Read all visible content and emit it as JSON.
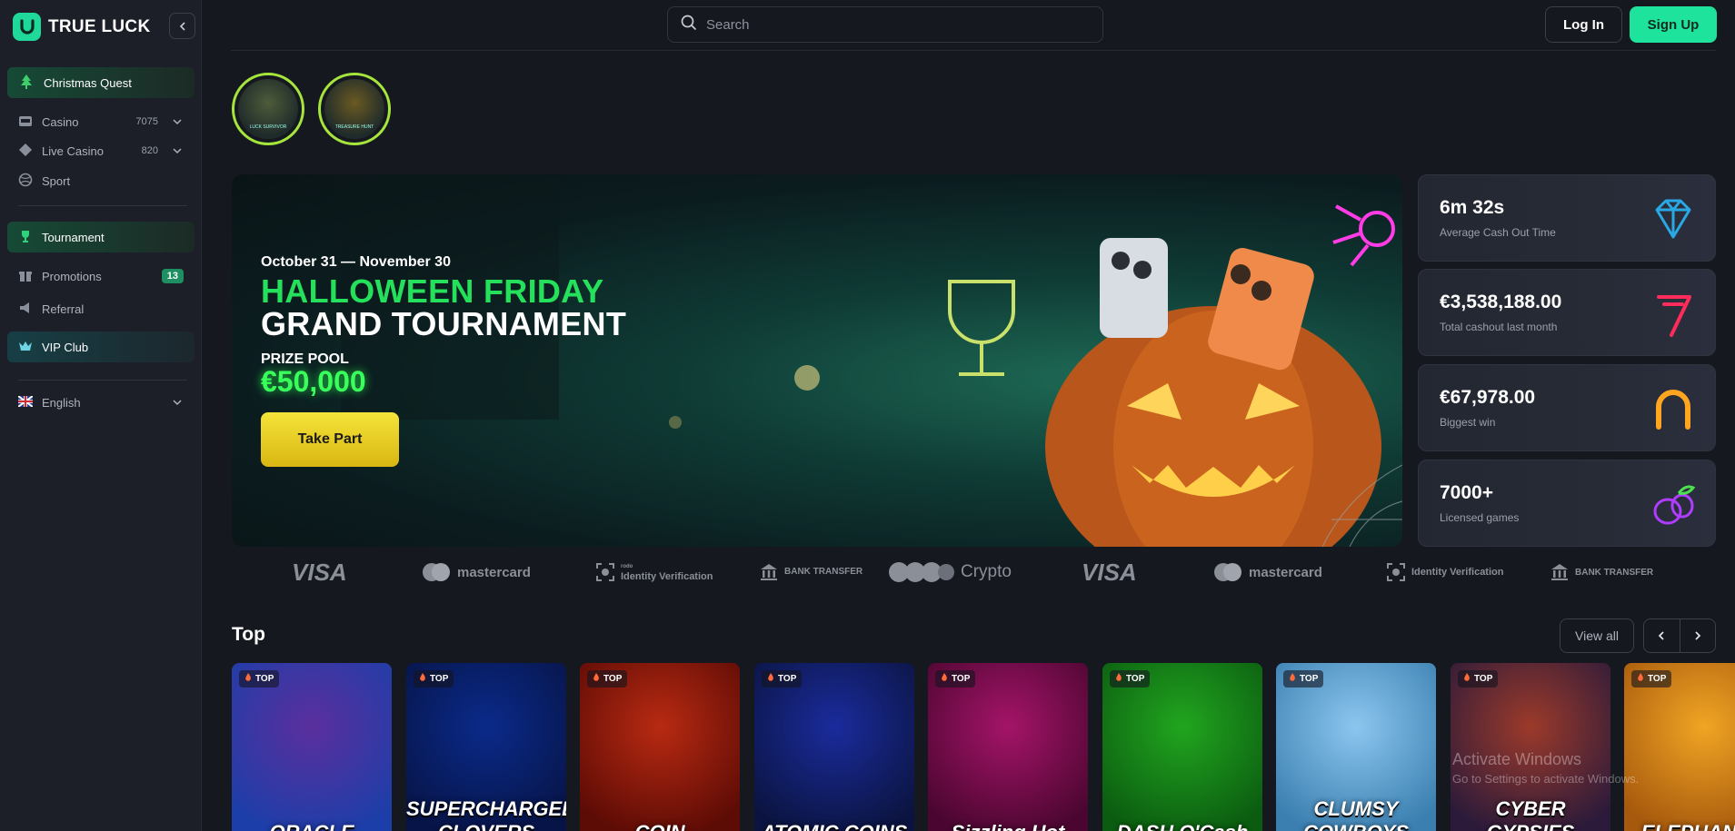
{
  "brand": {
    "name": "TRUE LUCK"
  },
  "sidebar": {
    "items": [
      {
        "label": "Christmas Quest"
      },
      {
        "label": "Casino",
        "count": "7075"
      },
      {
        "label": "Live Casino",
        "count": "820"
      },
      {
        "label": "Sport"
      },
      {
        "label": "Tournament"
      },
      {
        "label": "Promotions",
        "badge": "13"
      },
      {
        "label": "Referral"
      },
      {
        "label": "VIP Club"
      }
    ],
    "language": "English"
  },
  "header": {
    "search_placeholder": "Search",
    "login_label": "Log In",
    "signup_label": "Sign Up"
  },
  "stories": [
    {
      "caption": "LUCK SURVIVOR"
    },
    {
      "caption": "TREASURE HUNT"
    }
  ],
  "banner": {
    "date": "October 31 — November 30",
    "title_line1": "HALLOWEEN FRIDAY",
    "title_line2": "GRAND TOURNAMENT",
    "prize_label": "PRIZE POOL",
    "prize_value": "€50,000",
    "cta": "Take Part"
  },
  "stats": [
    {
      "value": "6m 32s",
      "label": "Average Cash Out Time",
      "icon": "diamond-icon",
      "color": "#2aa8e6"
    },
    {
      "value": "€3,538,188.00",
      "label": "Total cashout last month",
      "icon": "seven-icon",
      "color": "#ff2b5a"
    },
    {
      "value": "€67,978.00",
      "label": "Biggest win",
      "icon": "horseshoe-icon",
      "color": "#ffa51f"
    },
    {
      "value": "7000+",
      "label": "Licensed games",
      "icon": "plum-icon",
      "color": "#b03cff"
    }
  ],
  "payments": [
    "VISA",
    "mastercard",
    "Identity Verification",
    "BANK TRANSFER",
    "Crypto",
    "VISA",
    "mastercard",
    "Identity Verification",
    "BANK TRANSFER"
  ],
  "payments_small": {
    "identity_top": "rodo",
    "bank_top": "BANK",
    "bank_bottom": "TRANSFER"
  },
  "top_section": {
    "title": "Top",
    "view_all": "View all",
    "tag": "TOP",
    "games": [
      {
        "title": "ORACLE",
        "color1": "#5b2f9e",
        "color2": "#1c3ea8"
      },
      {
        "title": "SUPERCHARGED CLOVERS",
        "color1": "#0a2a8a",
        "color2": "#071447"
      },
      {
        "title": "COIN",
        "color1": "#b82a12",
        "color2": "#5c0b05"
      },
      {
        "title": "ATOMIC COINS",
        "color1": "#1a2b9c",
        "color2": "#0b1440"
      },
      {
        "title": "Sizzling Hot",
        "color1": "#a41468",
        "color2": "#4a0630"
      },
      {
        "title": "DASH O'Cash",
        "color1": "#21a51f",
        "color2": "#0b5c10"
      },
      {
        "title": "CLUMSY COWBOYS",
        "color1": "#8cc6ef",
        "color2": "#3a7fb0"
      },
      {
        "title": "CYBER GYPSIES",
        "color1": "#9c3a2a",
        "color2": "#2b1a3a"
      },
      {
        "title": "ELEPHANT'S",
        "color1": "#f0a524",
        "color2": "#a6580c"
      }
    ]
  },
  "windows_watermark": {
    "title": "Activate Windows",
    "subtitle": "Go to Settings to activate Windows."
  }
}
